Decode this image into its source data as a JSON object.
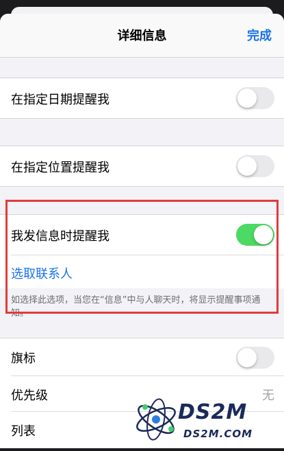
{
  "nav": {
    "title": "详细信息",
    "done": "完成"
  },
  "rows": {
    "date": {
      "label": "在指定日期提醒我",
      "on": false
    },
    "location": {
      "label": "在指定位置提醒我",
      "on": false
    },
    "messaging": {
      "label": "我发信息时提醒我",
      "on": true
    },
    "choose_contact": {
      "label": "选取联系人"
    },
    "messaging_note": "如选择此选项，当您在“信息”中与人聊天时，将显示提醒事项通知。",
    "flag": {
      "label": "旗标",
      "on": false
    },
    "priority": {
      "label": "优先级",
      "value": "无"
    },
    "list": {
      "label": "列表"
    }
  },
  "watermark": {
    "brand": "DS2M",
    "domain": "DS2M.COM"
  },
  "colors": {
    "accent": "#1a73e8",
    "toggle_on": "#4cd964",
    "highlight": "#e23a3a"
  }
}
